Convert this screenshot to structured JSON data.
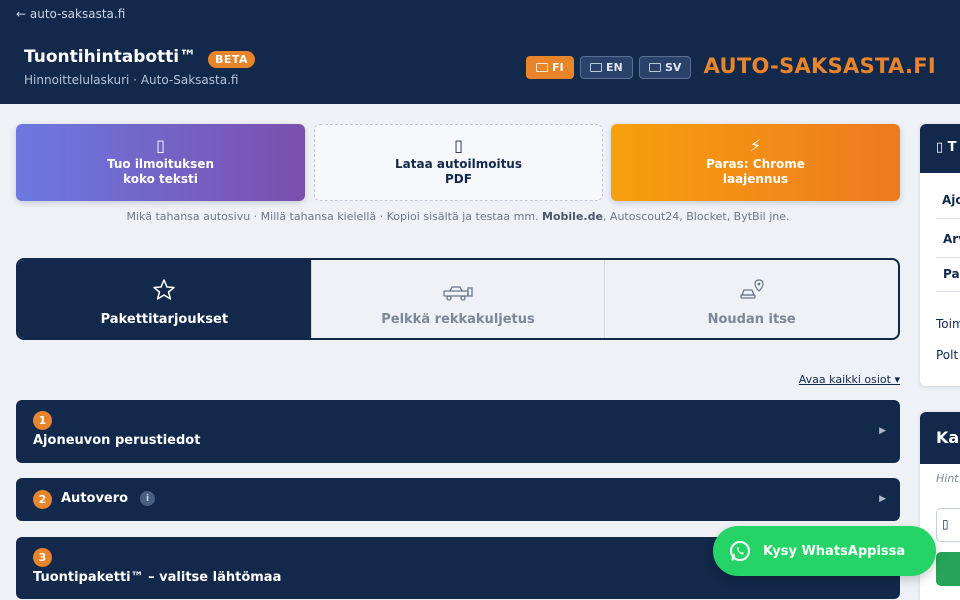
{
  "header": {
    "back_link": "← auto-saksasta.fi",
    "app_title": "Tuontihintabotti™",
    "beta_label": "BETA",
    "subtitle": "Hinnoittelulaskuri · Auto-Saksasta.fi",
    "languages": [
      {
        "code": "FI",
        "active": true
      },
      {
        "code": "EN",
        "active": false
      },
      {
        "code": "SV",
        "active": false
      }
    ],
    "brand": "AUTO-SAKSASTA.FI"
  },
  "import_cards": [
    {
      "icon": "clipboard-icon",
      "line1": "Tuo ilmoituksen",
      "line2": "koko teksti"
    },
    {
      "icon": "document-icon",
      "line1": "Lataa autoilmoitus",
      "line2": "PDF"
    },
    {
      "icon": "lightning-icon",
      "line1": "Paras: Chrome",
      "line2": "laajennus"
    }
  ],
  "hint": {
    "before": "Mikä tahansa autosivu · Millä tahansa kielellä · Kopioi sisältä ja testaa mm. ",
    "bold": "Mobile.de",
    "after": ", Autoscout24, Blocket, BytBil jne."
  },
  "tabs": [
    {
      "label": "Pakettitarjoukset",
      "icon": "star-icon",
      "active": true
    },
    {
      "label": "Pelkkä rekkakuljetus",
      "icon": "truck-icon",
      "active": false
    },
    {
      "label": "Noudan itse",
      "icon": "car-pin-icon",
      "active": false
    }
  ],
  "open_all": "Avaa kaikki osiot ▾",
  "sections": [
    {
      "num": "1",
      "title": "Ajoneuvon perustiedot",
      "arrow": "▶"
    },
    {
      "num": "2",
      "title": "Autovero",
      "info": "i",
      "arrow": "▶"
    },
    {
      "num": "3",
      "title": "Tuontipaketti™ – valitse lähtömaa",
      "arrow": "▶"
    }
  ],
  "side_panel": {
    "head": "▯ T",
    "rows": [
      "Ajo",
      "Arv",
      "Pa",
      "Toim",
      "Polt"
    ]
  },
  "calc_panel": {
    "head": "Ka",
    "sub": "Hint",
    "input_icon": "▯"
  },
  "whatsapp": {
    "label": "Kysy WhatsAppissa",
    "color": "#25d366"
  },
  "colors": {
    "navy": "#13294b",
    "orange": "#e8852a"
  }
}
